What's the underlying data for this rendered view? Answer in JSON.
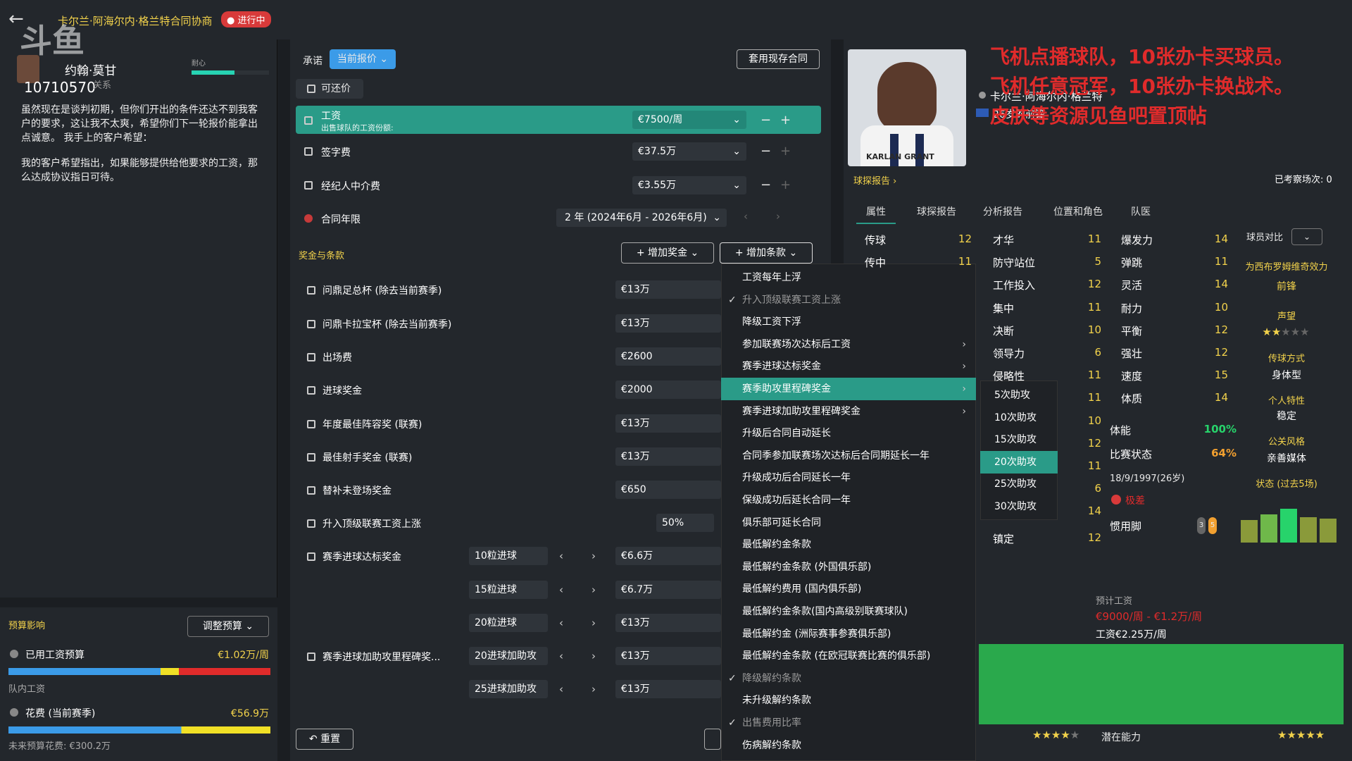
{
  "header": {
    "title": "卡尔兰·阿海尔内·格兰特合同协商",
    "status": "进行中",
    "logo": "斗鱼"
  },
  "agent": {
    "name": "约翰·莫甘",
    "id": "10710570",
    "relation": "关系",
    "patience_label": "耐心",
    "patience": 0.55,
    "message1": "虽然现在是谈判初期，但你们开出的条件还达不到我客户的要求，这让我不太爽，希望你们下一轮报价能拿出点诚意。 我手上的客户希望：",
    "message2": "我的客户希望指出，如果能够提供给他要求的工资，那么达成协议指日可待。"
  },
  "budget": {
    "title": "预算影响",
    "adjust": "调整预算",
    "wage_label": "已用工资预算",
    "wage_value": "€1.02万/周",
    "team_wage": "队内工资",
    "spend_label": "花费 (当前赛季)",
    "spend_value": "€56.9万",
    "remaining": "未来预算花费: €300.2万"
  },
  "center": {
    "promise_label": "承诺",
    "promise_value": "当前报价",
    "apply_button": "套用现存合同",
    "negotiable": "可还价",
    "wage_label": "工资",
    "wage_sub": "出售球队的工资份额:",
    "wage_value": "€7500/周",
    "sign_label": "签字费",
    "sign_value": "€37.5万",
    "agent_label": "经纪人中介费",
    "agent_value": "€3.55万",
    "length_label": "合同年限",
    "length_value": "2 年 (2024年6月 - 2026年6月)",
    "bonus_header": "奖金与条款",
    "add_bonus": "增加奖金",
    "add_clause": "增加条款",
    "bonuses": [
      {
        "label": "问鼎足总杯 (除去当前赛季)",
        "value": "€13万"
      },
      {
        "label": "问鼎卡拉宝杯 (除去当前赛季)",
        "value": "€13万"
      },
      {
        "label": "出场费",
        "value": "€2600"
      },
      {
        "label": "进球奖金",
        "value": "€2000"
      },
      {
        "label": "年度最佳阵容奖 (联赛)",
        "value": "€13万"
      },
      {
        "label": "最佳射手奖金 (联赛)",
        "value": "€13万"
      },
      {
        "label": "替补未登场奖金",
        "value": "€650"
      },
      {
        "label": "升入顶级联赛工资上涨",
        "value": "",
        "pct": "50%"
      },
      {
        "label": "赛季进球达标奖金",
        "value": "€6.6万",
        "opt": "10粒进球"
      },
      {
        "label": "",
        "value": "€6.7万",
        "opt": "15粒进球"
      },
      {
        "label": "",
        "value": "€13万",
        "opt": "20粒进球"
      },
      {
        "label": "赛季进球加助攻里程碑奖...",
        "value": "€13万",
        "opt": "20进球加助攻"
      },
      {
        "label": "",
        "value": "€13万",
        "opt": "25进球加助攻"
      }
    ],
    "reset": "重置"
  },
  "menu": {
    "items": [
      {
        "label": "工资每年上浮",
        "check": false,
        "arrow": false
      },
      {
        "label": "升入顶级联赛工资上涨",
        "check": true,
        "arrow": false,
        "dim": true
      },
      {
        "label": "降级工资下浮",
        "check": false,
        "arrow": false
      },
      {
        "label": "参加联赛场次达标后工资",
        "check": false,
        "arrow": true
      },
      {
        "label": "赛季进球达标奖金",
        "check": false,
        "arrow": true
      },
      {
        "label": "赛季助攻里程碑奖金",
        "check": false,
        "arrow": true,
        "active": true
      },
      {
        "label": "赛季进球加助攻里程碑奖金",
        "check": false,
        "arrow": true
      },
      {
        "label": "升级后合同自动延长",
        "check": false,
        "arrow": false
      },
      {
        "label": "合同季参加联赛场次达标后合同期延长一年",
        "check": false,
        "arrow": false
      },
      {
        "label": "升级成功后合同延长一年",
        "check": false,
        "arrow": false
      },
      {
        "label": "保级成功后延长合同一年",
        "check": false,
        "arrow": false
      },
      {
        "label": "俱乐部可延长合同",
        "check": false,
        "arrow": false
      },
      {
        "label": "最低解约金条款",
        "check": false,
        "arrow": false
      },
      {
        "label": "最低解约金条款 (外国俱乐部)",
        "check": false,
        "arrow": false
      },
      {
        "label": "最低解约费用 (国内俱乐部)",
        "check": false,
        "arrow": false
      },
      {
        "label": "最低解约金条款(国内高级别联赛球队)",
        "check": false,
        "arrow": false
      },
      {
        "label": "最低解约金 (洲际赛事参赛俱乐部)",
        "check": false,
        "arrow": false
      },
      {
        "label": "最低解约金条款 (在欧冠联赛比赛的俱乐部)",
        "check": false,
        "arrow": false
      },
      {
        "label": "降级解约条款",
        "check": true,
        "arrow": false,
        "dim": true
      },
      {
        "label": "未升级解约条款",
        "check": false,
        "arrow": false
      },
      {
        "label": "出售费用比率",
        "check": true,
        "arrow": false,
        "dim": true
      },
      {
        "label": "伤病解约条款",
        "check": false,
        "arrow": false
      }
    ],
    "submenu": [
      "5次助攻",
      "10次助攻",
      "15次助攻",
      "20次助攻",
      "25次助攻",
      "30次助攻"
    ]
  },
  "player": {
    "name": "卡尔兰·阿海尔内·格兰特",
    "age_pos": "26岁的前锋",
    "shirt": "KARLAN GRANT",
    "scout": "球探报告",
    "seen": "已考察场次: 0",
    "tabs": [
      "属性",
      "球探报告",
      "分析报告",
      "位置和角色",
      "队医"
    ],
    "col1": [
      {
        "k": "传球",
        "v": "12"
      },
      {
        "k": "传中",
        "v": "11"
      }
    ],
    "col2": [
      {
        "k": "才华",
        "v": "11"
      },
      {
        "k": "防守站位",
        "v": "5"
      },
      {
        "k": "工作投入",
        "v": "12"
      },
      {
        "k": "集中",
        "v": "11"
      },
      {
        "k": "决断",
        "v": "10"
      },
      {
        "k": "领导力",
        "v": "6"
      },
      {
        "k": "侵略性",
        "v": "11"
      },
      {
        "k": "",
        "v": "11"
      },
      {
        "k": "",
        "v": "10"
      },
      {
        "k": "",
        "v": "12"
      },
      {
        "k": "",
        "v": "11"
      },
      {
        "k": "",
        "v": "6"
      },
      {
        "k": "",
        "v": "14"
      },
      {
        "k": "镇定",
        "v": "12"
      }
    ],
    "col3": [
      {
        "k": "爆发力",
        "v": "14"
      },
      {
        "k": "弹跳",
        "v": "11"
      },
      {
        "k": "灵活",
        "v": "14"
      },
      {
        "k": "耐力",
        "v": "10"
      },
      {
        "k": "平衡",
        "v": "12"
      },
      {
        "k": "强壮",
        "v": "12"
      },
      {
        "k": "速度",
        "v": "15"
      },
      {
        "k": "体质",
        "v": "14"
      }
    ],
    "stamina_label": "体能",
    "stamina": "100%",
    "form_label": "比赛状态",
    "form": "64%",
    "dob": "18/9/1997(26岁)",
    "risk": "极差",
    "foot_label": "惯用脚",
    "foot_l": "3",
    "foot_r": "5",
    "compare": "球员对比",
    "club_label": "为西布罗姆维奇效力",
    "club_pos": "前锋",
    "rep_label": "声望",
    "style_label": "传球方式",
    "style": "身体型",
    "pers_label": "个人特性",
    "pers": "稳定",
    "media_label": "公关风格",
    "media": "亲善媒体",
    "form5": "状态 (过去5场)",
    "wage_label": "预计工资",
    "wage_range": "€9000/周 - €1.2万/周",
    "wage_now": "工资€2.25万/周",
    "potential": "潜在能力"
  },
  "ad": {
    "line1": "飞机点播球队，10张办卡买球员。",
    "line2": "飞机任意冠军，10张办卡换战术。",
    "line3": "皮肤等资源见鱼吧置顶帖"
  },
  "colors": {
    "accent": "#2a9b88",
    "gold": "#f2d24b",
    "red": "#e02b2b"
  }
}
